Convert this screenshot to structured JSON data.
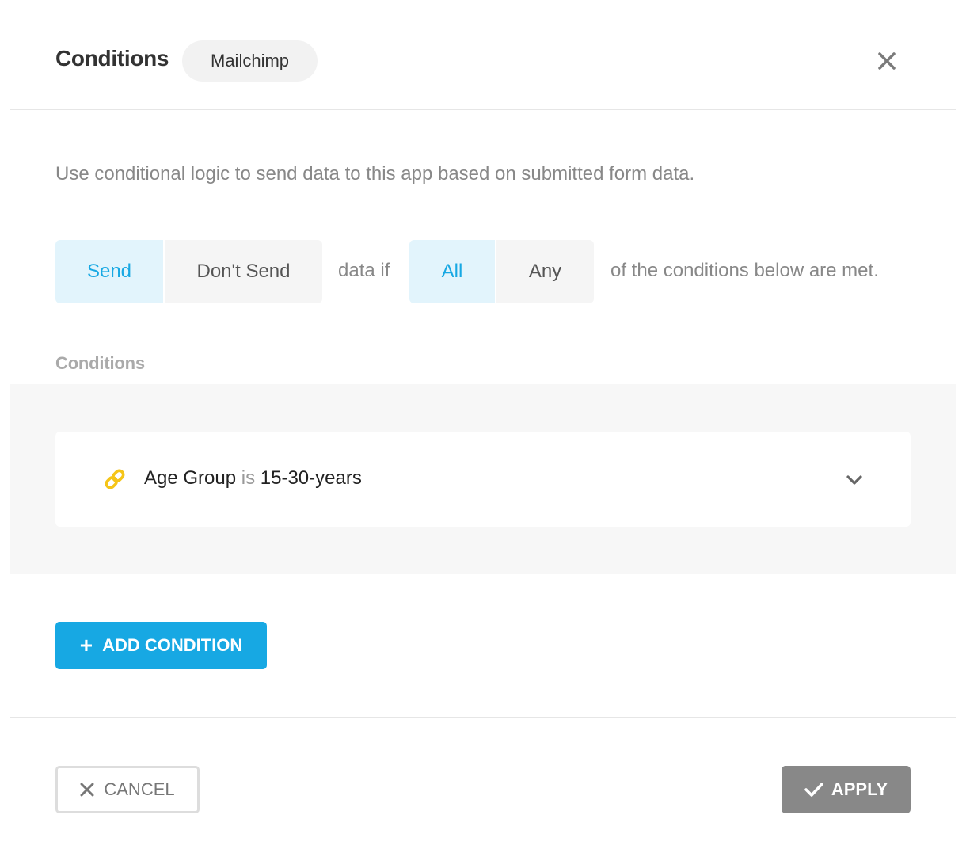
{
  "header": {
    "title": "Conditions",
    "app_name": "Mailchimp"
  },
  "description": "Use conditional logic to send data to this app based on submitted form data.",
  "logic": {
    "action_options": [
      "Send",
      "Don't Send"
    ],
    "action_selected": "Send",
    "connector_text": "data if",
    "match_options": [
      "All",
      "Any"
    ],
    "match_selected": "All",
    "trailing_text": "of the conditions below are met."
  },
  "conditions": {
    "label": "Conditions",
    "items": [
      {
        "field": "Age Group",
        "operator": "is",
        "value": "15-30-years",
        "icon": "link-icon"
      }
    ]
  },
  "add_button_label": "ADD CONDITION",
  "footer": {
    "cancel_label": "CANCEL",
    "apply_label": "APPLY"
  },
  "colors": {
    "accent": "#17a8e3",
    "accent_light": "#e2f4fc",
    "link_icon": "#f5c518",
    "apply_disabled": "#888888"
  }
}
